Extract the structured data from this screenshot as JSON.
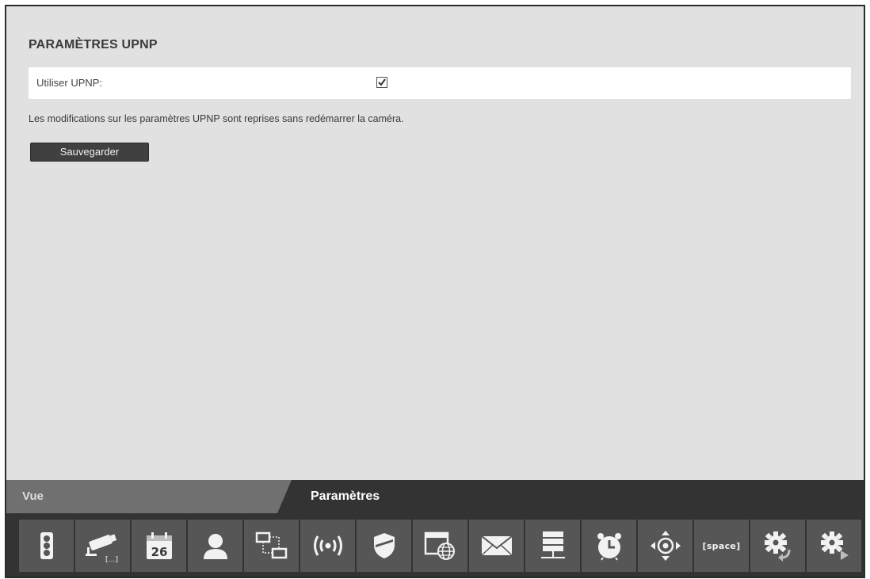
{
  "section": {
    "title": "PARAMÈTRES UPNP",
    "setting_label": "Utiliser UPNP:",
    "checked": true,
    "note": "Les modifications sur les paramètres UPNP sont reprises sans redémarrer la caméra.",
    "save_label": "Sauvegarder"
  },
  "tabs": {
    "vue": "Vue",
    "parametres": "Paramètres"
  },
  "toolbar": {
    "calendar_day": "26",
    "space_label": "[space]",
    "icons": [
      "traffic-light-icon",
      "camera-settings-icon",
      "calendar-icon",
      "user-icon",
      "network-topology-icon",
      "wireless-icon",
      "shield-icon",
      "web-browser-icon",
      "email-icon",
      "server-icon",
      "alarm-clock-icon",
      "ptz-icon",
      "space-icon",
      "gear-restore-icon",
      "gear-play-icon"
    ]
  },
  "colors": {
    "background": "#e1e1e1",
    "bottom_bar": "#333333",
    "tile": "#565656",
    "button": "#404040"
  }
}
